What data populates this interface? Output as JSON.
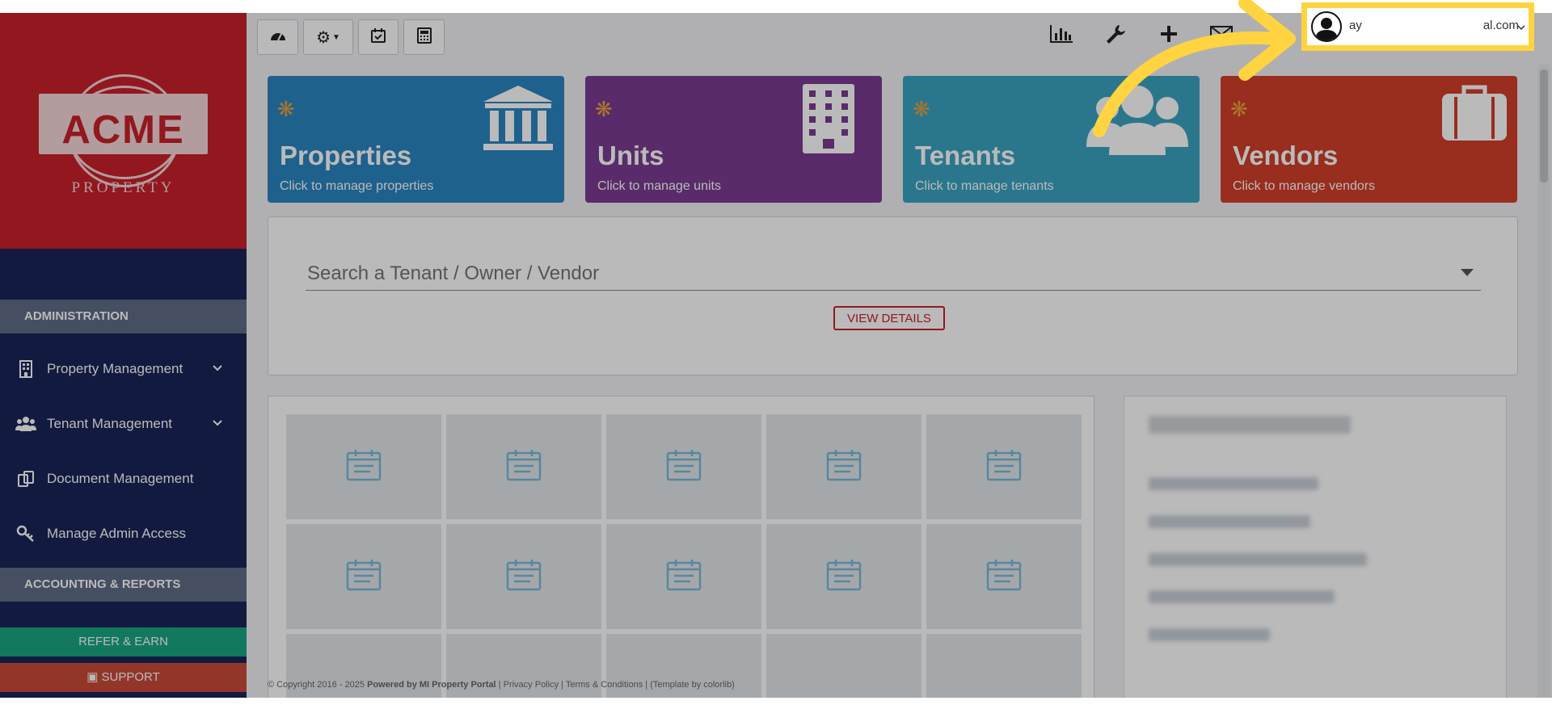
{
  "sidebar": {
    "logo_main": "ACME",
    "logo_sub": "PROPERTY",
    "sections": [
      "ADMINISTRATION",
      "ACCOUNTING & REPORTS"
    ],
    "items": [
      {
        "label": "Property Management",
        "icon": "building-icon",
        "expandable": true
      },
      {
        "label": "Tenant Management",
        "icon": "users-icon",
        "expandable": true
      },
      {
        "label": "Document Management",
        "icon": "documents-icon",
        "expandable": false
      },
      {
        "label": "Manage Admin Access",
        "icon": "key-icon",
        "expandable": false
      }
    ],
    "refer_label": "REFER & EARN",
    "support_label": "SUPPORT"
  },
  "toolbar": {
    "buttons": [
      "dashboard-icon",
      "gear-icon",
      "calendar-check-icon",
      "calculator-icon"
    ],
    "right_icons": [
      "bar-chart-icon",
      "wrench-icon",
      "plus-icon",
      "envelope-icon"
    ]
  },
  "user": {
    "email": "ay          al.com"
  },
  "cards": [
    {
      "title": "Properties",
      "subtitle": "Click to manage properties",
      "color": "#2a86c0",
      "icon": "bank-icon"
    },
    {
      "title": "Units",
      "subtitle": "Click to manage units",
      "color": "#7b3c92",
      "icon": "apartment-icon"
    },
    {
      "title": "Tenants",
      "subtitle": "Click to manage tenants",
      "color": "#3aa4c2",
      "icon": "group-icon"
    },
    {
      "title": "Vendors",
      "subtitle": "Click to manage vendors",
      "color": "#d23e2a",
      "icon": "briefcase-icon"
    }
  ],
  "search": {
    "placeholder": "Search a Tenant / Owner / Vendor",
    "button_label": "VIEW DETAILS"
  },
  "footer": {
    "copyright": "© Copyright 2016 - 2025",
    "powered": "Powered by MI Property Portal",
    "links": [
      "Privacy Policy",
      "Terms & Conditions"
    ],
    "template": "(Template by colorlib)"
  },
  "colors": {
    "accent": "#c8202a",
    "sidebar": "#1a2457",
    "highlight": "#ffd440",
    "refer": "#1aa783",
    "support": "#c84a3a"
  }
}
